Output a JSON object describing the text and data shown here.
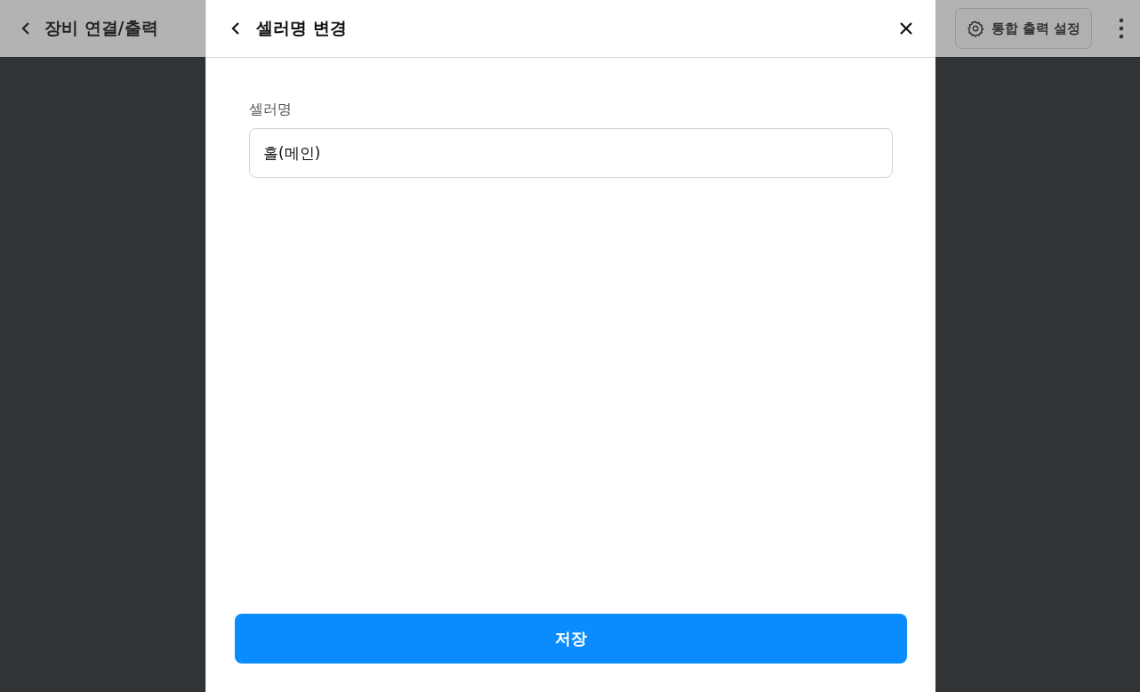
{
  "app_header": {
    "title": "장비 연결/출력",
    "settings_button": "통합 출력 설정"
  },
  "dialog": {
    "title": "셀러명 변경",
    "field": {
      "label": "셀러명",
      "value": "홀(메인)"
    },
    "save_button": "저장"
  }
}
